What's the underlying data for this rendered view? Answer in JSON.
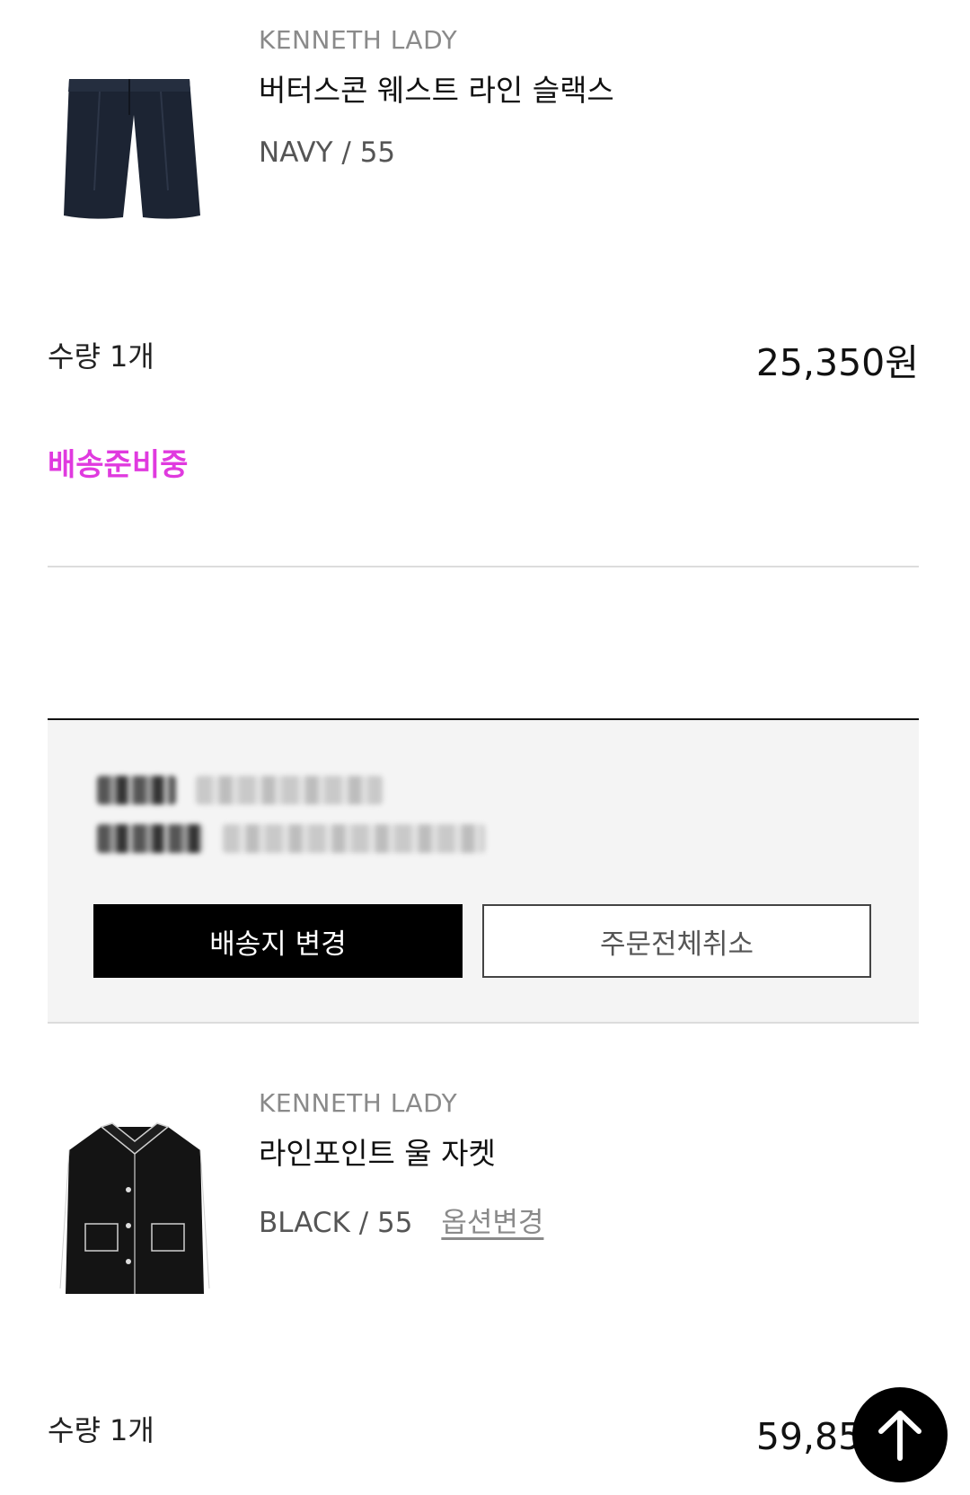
{
  "items": [
    {
      "brand": "KENNETH LADY",
      "name": "버터스콘 웨스트 라인 슬랙스",
      "option": "NAVY / 55",
      "option_change": "",
      "qty": "수량 1개",
      "price": "25,350원",
      "status": "배송준비중",
      "image_icon": "navy-shorts-image"
    },
    {
      "brand": "KENNETH LADY",
      "name": "라인포인트 울 자켓",
      "option": "BLACK / 55",
      "option_change": "옵션변경",
      "qty": "수량 1개",
      "price": "59,850원",
      "image_icon": "black-jacket-image"
    }
  ],
  "order_info": {
    "buttons": {
      "change_address": "배송지 변경",
      "cancel_all": "주문전체취소"
    }
  },
  "colors": {
    "status": "#e03adf",
    "primary_button": "#000000",
    "panel_bg": "#f4f4f4"
  },
  "fab": {
    "icon": "arrow-up-icon"
  }
}
